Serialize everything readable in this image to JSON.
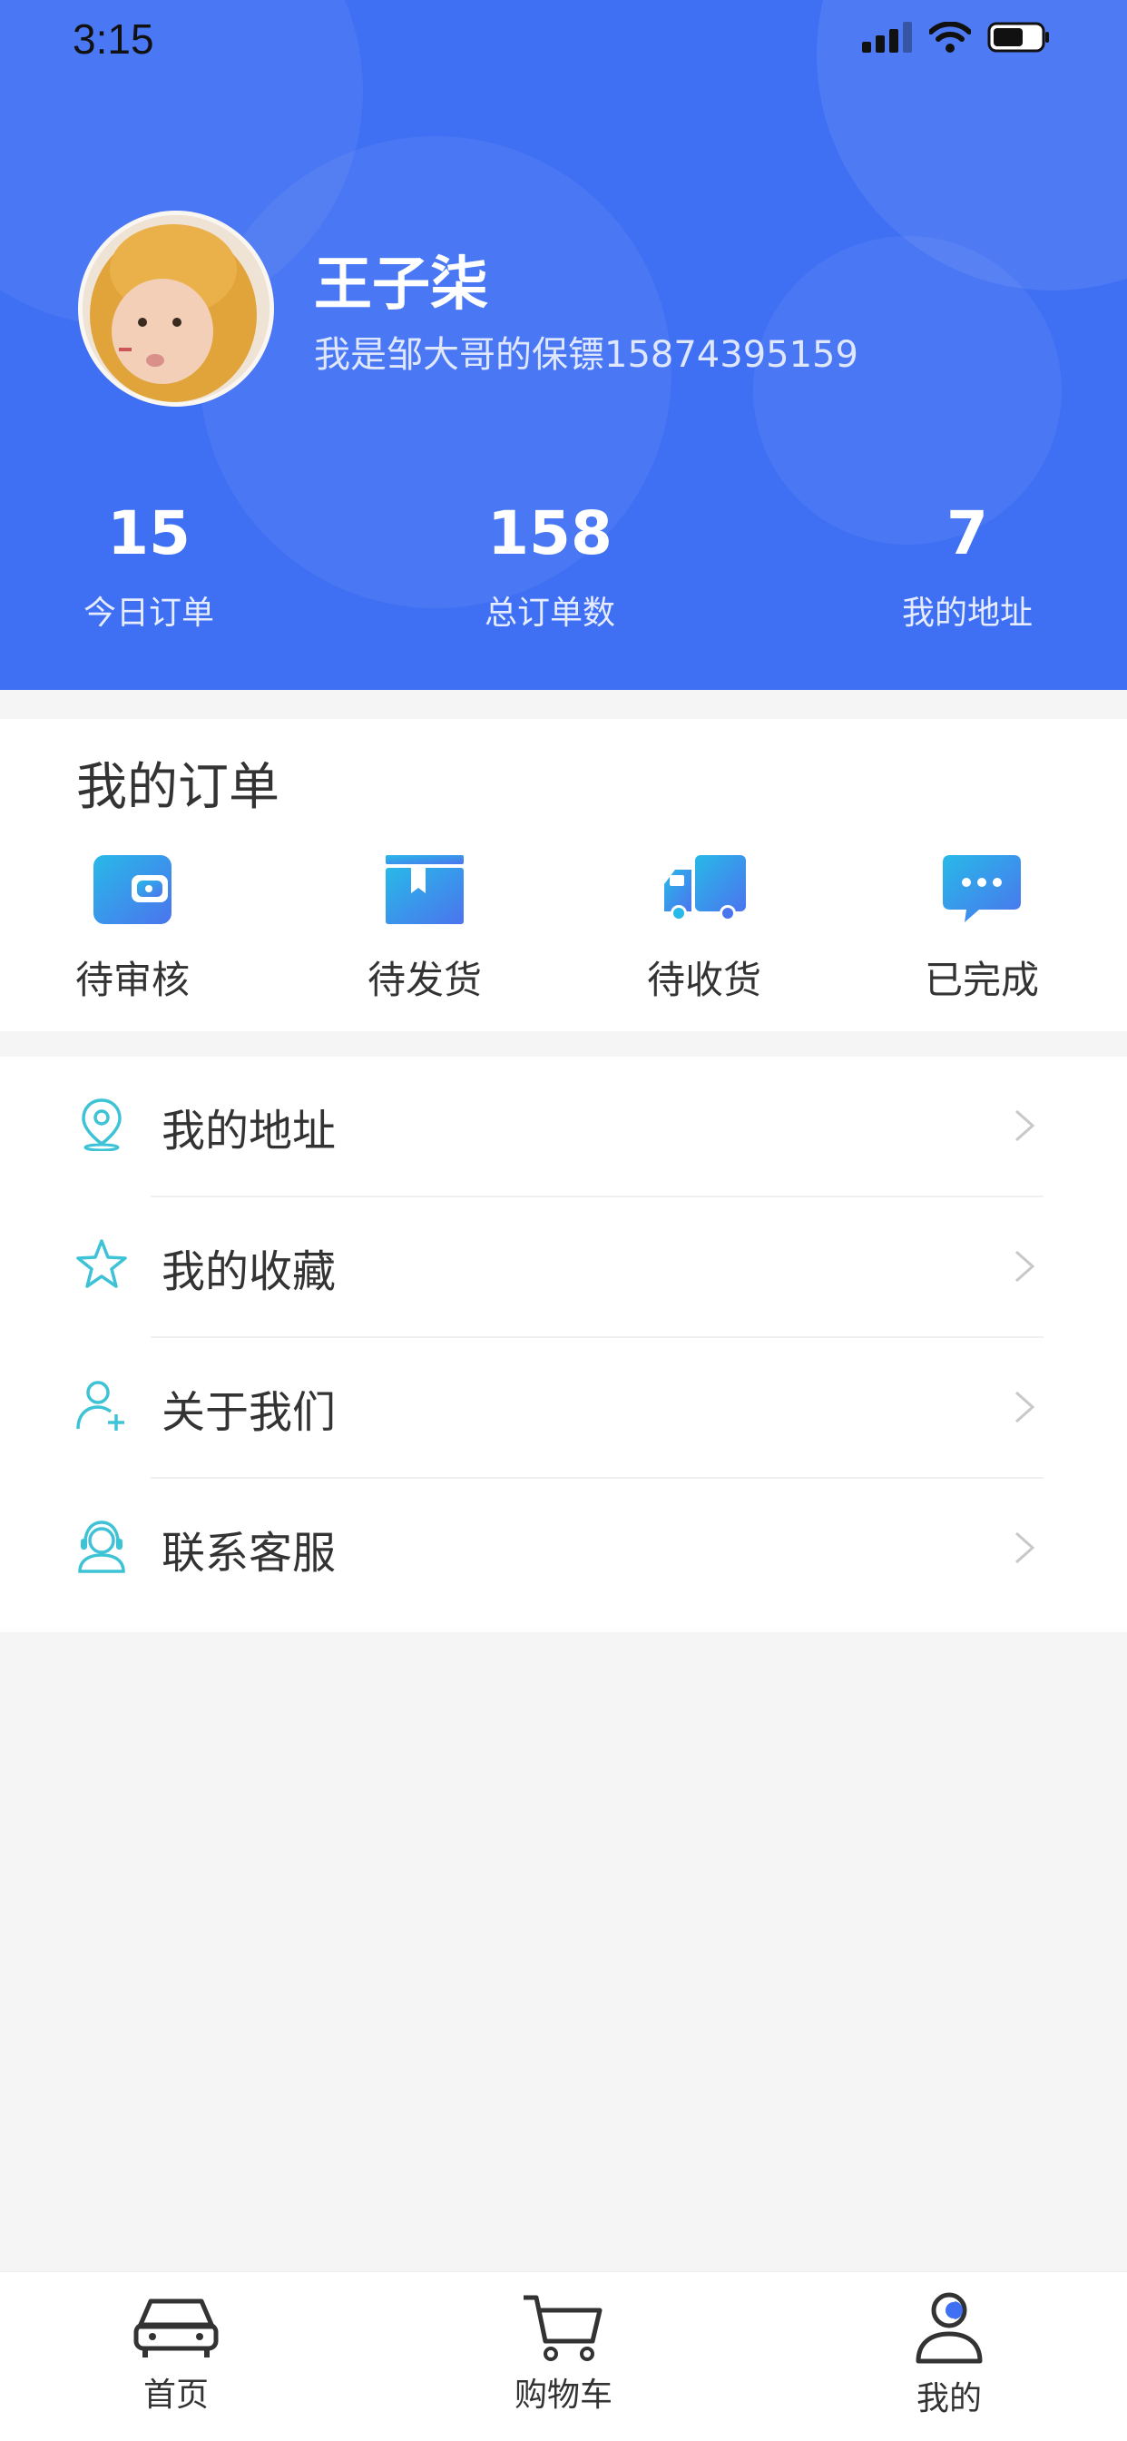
{
  "status_bar": {
    "time": "3:15"
  },
  "profile": {
    "name": "王子柒",
    "bio": "我是邹大哥的保镖15874395159"
  },
  "stats": [
    {
      "value": "15",
      "label": "今日订单"
    },
    {
      "value": "158",
      "label": "总订单数"
    },
    {
      "value": "7",
      "label": "我的地址"
    }
  ],
  "orders": {
    "title": "我的订单",
    "items": [
      {
        "label": "待审核",
        "icon": "wallet-icon"
      },
      {
        "label": "待发货",
        "icon": "box-icon"
      },
      {
        "label": "待收货",
        "icon": "truck-icon"
      },
      {
        "label": "已完成",
        "icon": "chat-bubble-icon"
      }
    ]
  },
  "menu": [
    {
      "label": "我的地址",
      "icon": "location-pin-icon"
    },
    {
      "label": "我的收藏",
      "icon": "star-icon"
    },
    {
      "label": "关于我们",
      "icon": "user-add-icon"
    },
    {
      "label": "联系客服",
      "icon": "headset-icon"
    }
  ],
  "tabbar": [
    {
      "label": "首页",
      "icon": "car-icon"
    },
    {
      "label": "购物车",
      "icon": "cart-icon"
    },
    {
      "label": "我的",
      "icon": "profile-icon",
      "active": true
    }
  ],
  "colors": {
    "header_blue": "#3f6ff3",
    "icon_gradient_start": "#28b9e8",
    "icon_gradient_end": "#4b74ee",
    "menu_icon": "#3ec3d6"
  }
}
